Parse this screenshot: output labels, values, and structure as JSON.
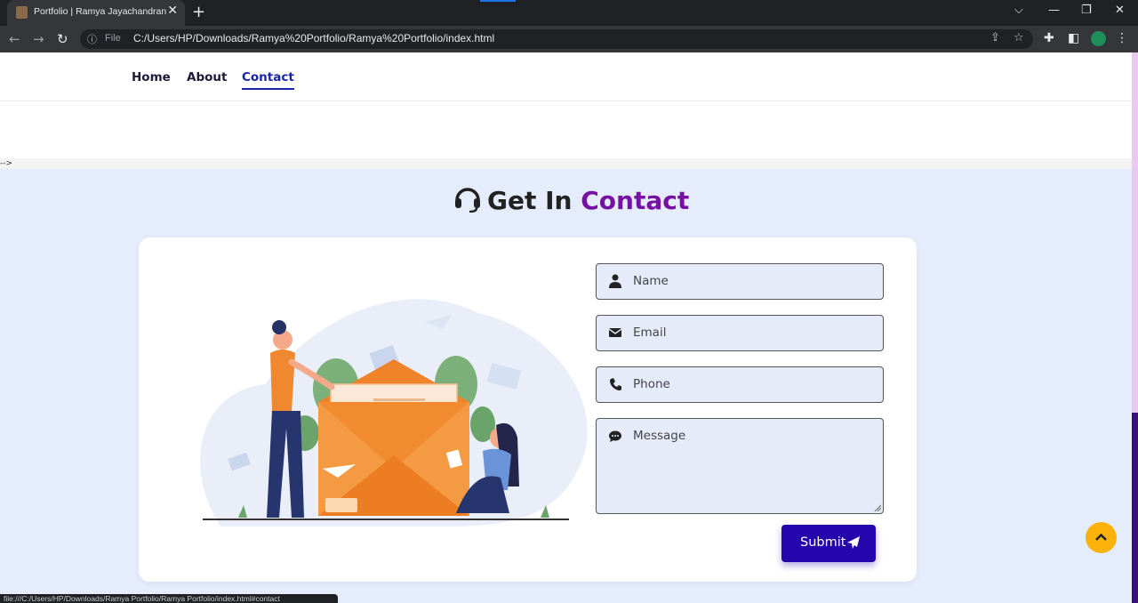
{
  "browser": {
    "tab_title": "Portfolio | Ramya Jayachandran",
    "tab_close": "✕",
    "new_tab": "+",
    "file_label": "File",
    "url": "C:/Users/HP/Downloads/Ramya%20Portfolio/Ramya%20Portfolio/index.html",
    "status_url": "file:///C:/Users/HP/Downloads/Ramya Portfolio/Ramya Portfolio/index.html#contact"
  },
  "nav": {
    "home": "Home",
    "about": "About",
    "contact": "Contact"
  },
  "comment_text": "-->",
  "contact": {
    "heading_plain": "Get In ",
    "heading_accent": "Contact",
    "name_placeholder": "Name",
    "email_placeholder": "Email",
    "phone_placeholder": "Phone",
    "message_placeholder": "Message",
    "submit_label": "Submit"
  },
  "colors": {
    "accent_purple": "#7711a3",
    "submit_blue": "#2506ad",
    "scroll_top_yellow": "#fbb20b",
    "page_bg": "#e5ecfb"
  }
}
